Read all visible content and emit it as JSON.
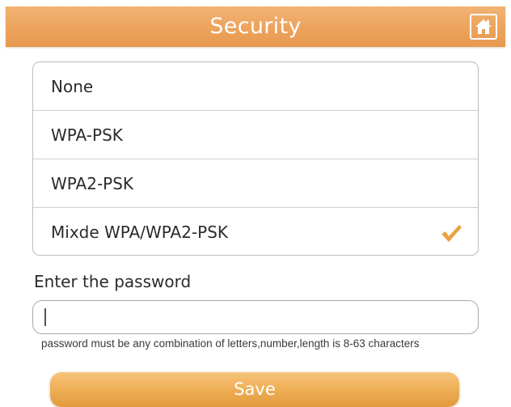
{
  "header": {
    "title": "Security",
    "icon": "home-icon"
  },
  "security_options": [
    {
      "label": "None",
      "selected": false
    },
    {
      "label": "WPA-PSK",
      "selected": false
    },
    {
      "label": "WPA2-PSK",
      "selected": false
    },
    {
      "label": "Mixde WPA/WPA2-PSK",
      "selected": true
    }
  ],
  "password": {
    "label": "Enter the password",
    "value": "",
    "placeholder": "",
    "hint": "password must be any combination of letters,number,length is 8-63 characters"
  },
  "save_button": {
    "label": "Save"
  },
  "colors": {
    "accent": "#eca35c",
    "check": "#e8a23f"
  }
}
